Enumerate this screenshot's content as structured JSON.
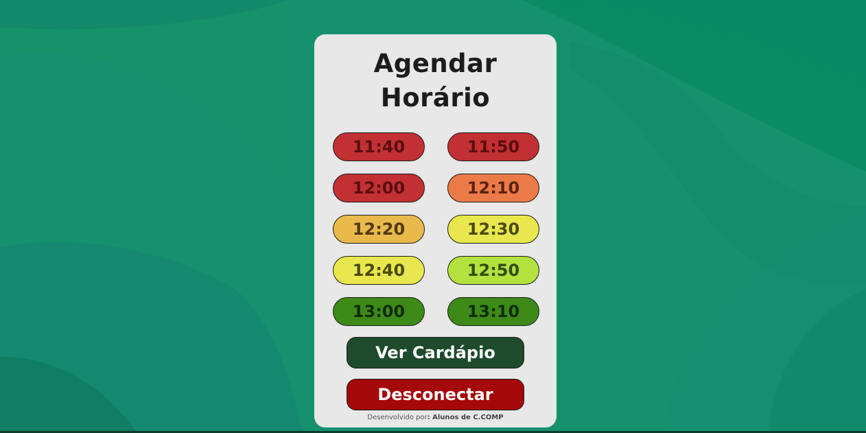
{
  "page": {
    "title_line1": "Agendar",
    "title_line2": "Horário"
  },
  "slots": [
    {
      "label": "11:40",
      "bg": "#c23033",
      "fg": "#5a0d0f"
    },
    {
      "label": "11:50",
      "bg": "#c23033",
      "fg": "#5a0d0f"
    },
    {
      "label": "12:00",
      "bg": "#c23033",
      "fg": "#5a0d0f"
    },
    {
      "label": "12:10",
      "bg": "#ec7a48",
      "fg": "#5c2210"
    },
    {
      "label": "12:20",
      "bg": "#e9b94b",
      "fg": "#4f3a0b"
    },
    {
      "label": "12:30",
      "bg": "#e8e84e",
      "fg": "#4a4a0b"
    },
    {
      "label": "12:40",
      "bg": "#e8e84e",
      "fg": "#4a4a0b"
    },
    {
      "label": "12:50",
      "bg": "#b3e23f",
      "fg": "#334d0b"
    },
    {
      "label": "13:00",
      "bg": "#3d8a19",
      "fg": "#0f2d05"
    },
    {
      "label": "13:10",
      "bg": "#3d8a19",
      "fg": "#0f2d05"
    }
  ],
  "actions": {
    "menu_label": "Ver Cardápio",
    "menu_color": "#1e4b2c",
    "logout_label": "Desconectar",
    "logout_color": "#a50808"
  },
  "footer": {
    "prefix": "Desenvolvido por",
    "author": ": Alunos de C.COMP"
  },
  "colors": {
    "background": "#15916d",
    "card": "#e8e8e8"
  }
}
